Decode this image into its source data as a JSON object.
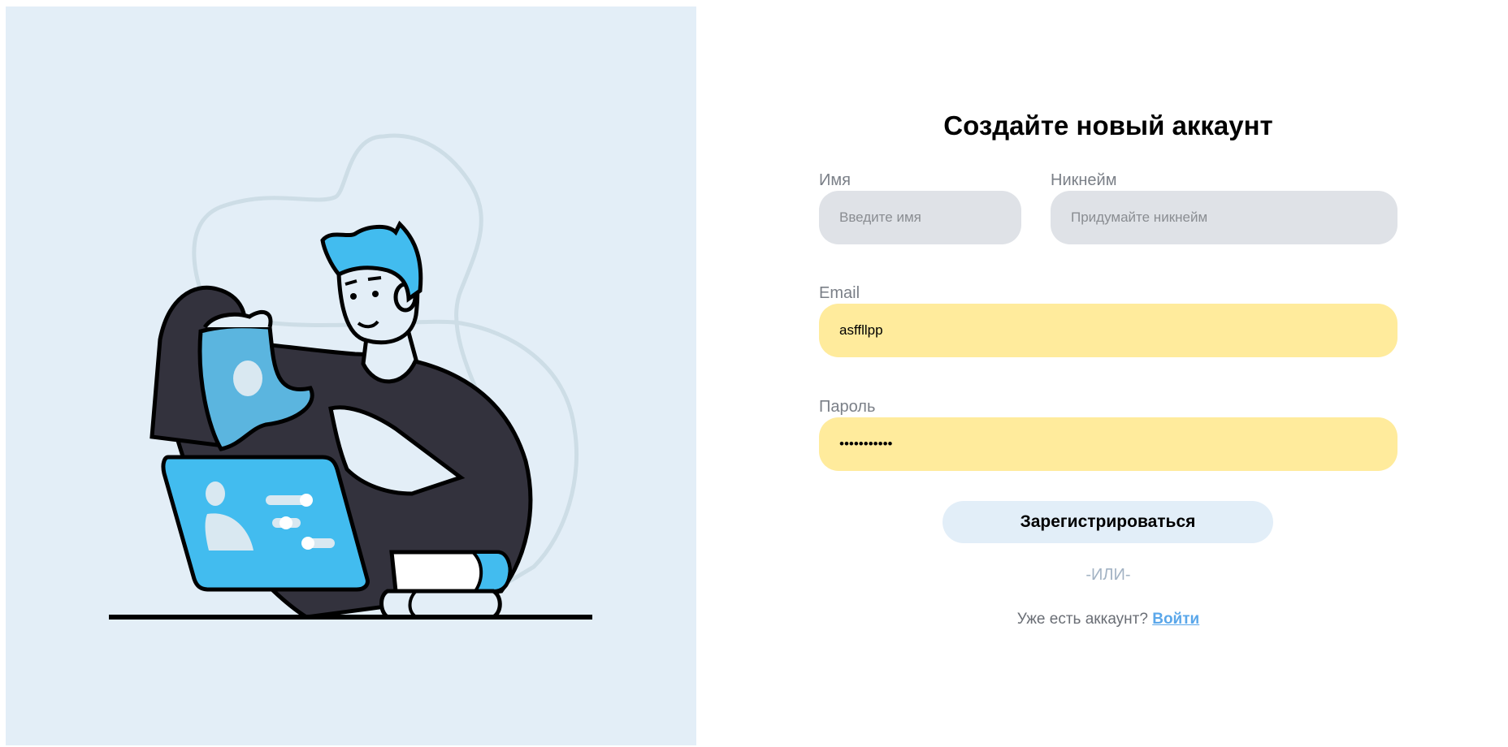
{
  "form": {
    "title": "Создайте новый аккаунт",
    "name": {
      "label": "Имя",
      "placeholder": "Введите имя",
      "value": ""
    },
    "nickname": {
      "label": "Никнейм",
      "placeholder": "Придумайте никнейм",
      "value": ""
    },
    "email": {
      "label": "Email",
      "value": "asffllpp"
    },
    "password": {
      "label": "Пароль",
      "value": "•••••••••••"
    },
    "submit_label": "Зарегистрироваться",
    "or_text": "-ИЛИ-",
    "login_prompt": "Уже есть аккаунт?",
    "login_link": "Войти"
  },
  "colors": {
    "panel_background": "#e3eef7",
    "input_empty": "#dfe2e7",
    "input_filled": "#ffeb9c",
    "button_background": "#e2eef8",
    "link": "#5aa7ea",
    "illustration_blue": "#42bcef",
    "illustration_dark": "#33323d"
  },
  "illustration": {
    "icon": "person-with-laptop-illustration"
  }
}
